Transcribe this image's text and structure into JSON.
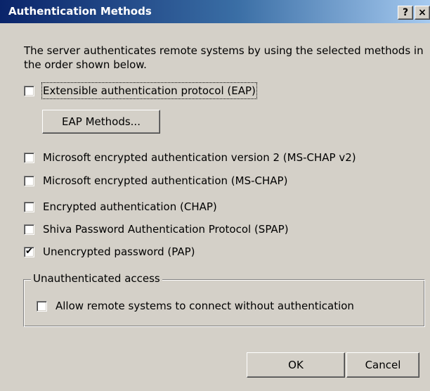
{
  "window": {
    "title": "Authentication Methods",
    "help_glyph": "?",
    "close_glyph": "×"
  },
  "description": "The server authenticates remote systems by using the selected methods in the order shown below.",
  "methods": [
    {
      "label": "Extensible authentication protocol (EAP)",
      "checked": false
    },
    {
      "label": "Microsoft encrypted authentication version 2 (MS-CHAP v2)",
      "checked": false
    },
    {
      "label": "Microsoft encrypted authentication (MS-CHAP)",
      "checked": false
    },
    {
      "label": "Encrypted authentication (CHAP)",
      "checked": false
    },
    {
      "label": "Shiva Password Authentication Protocol (SPAP)",
      "checked": false
    },
    {
      "label": "Unencrypted password (PAP)",
      "checked": true
    }
  ],
  "eap_methods_button": "EAP Methods...",
  "unauthenticated": {
    "legend": "Unauthenticated access",
    "option": {
      "label": "Allow remote systems to connect without authentication",
      "checked": false
    }
  },
  "buttons": {
    "ok": "OK",
    "cancel": "Cancel"
  },
  "check_glyph": "✔"
}
